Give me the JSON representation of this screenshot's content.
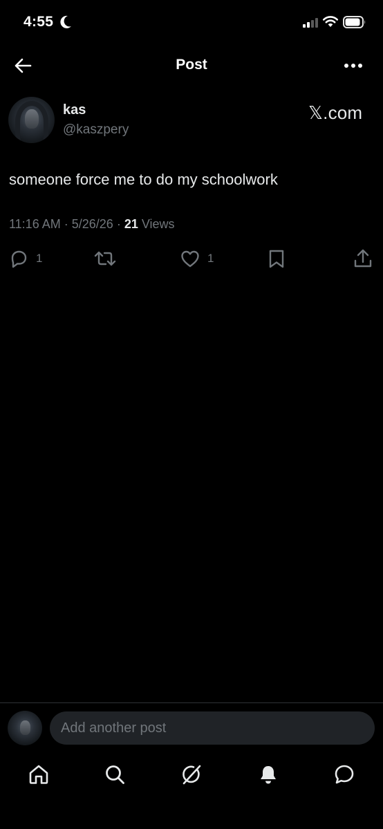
{
  "status_bar": {
    "time": "4:55",
    "icons": [
      "moon-icon",
      "cellular-signal-icon",
      "wifi-icon",
      "battery-icon"
    ]
  },
  "header": {
    "title": "Post",
    "back_icon": "arrow-left-icon",
    "more_icon": "more-horizontal-icon"
  },
  "post": {
    "author": {
      "display_name": "kas",
      "handle": "@kaszpery"
    },
    "watermark": "𝕏.com",
    "text": "someone force me to do my schoolwork",
    "time": "11:16 AM",
    "date": "5/26/26",
    "views_count": "21",
    "views_label": "Views",
    "actions": {
      "replies": "1",
      "reposts": "",
      "likes": "1"
    }
  },
  "composer": {
    "placeholder": "Add another post"
  },
  "tab_bar": {
    "items": [
      "home-icon",
      "search-icon",
      "grok-icon",
      "notifications-icon",
      "messages-icon"
    ]
  },
  "colors": {
    "background": "#000000",
    "text_primary": "#e7e9ea",
    "text_secondary": "#71767b",
    "input_bg": "#202327",
    "divider": "#2f3336"
  }
}
